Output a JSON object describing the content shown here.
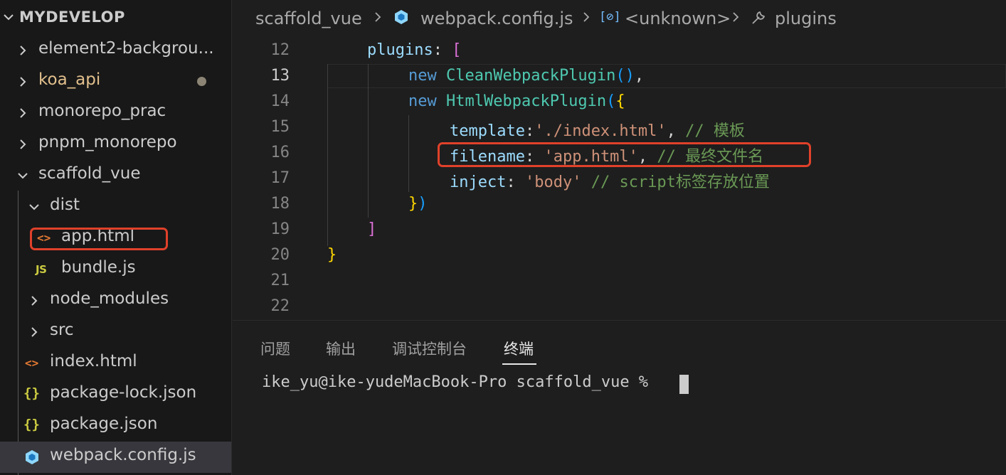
{
  "explorer": {
    "title": "MYDEVELOP",
    "items": [
      {
        "label": "element2-backgrou...",
        "type": "folder",
        "collapsed": true
      },
      {
        "label": "koa_api",
        "type": "folder",
        "collapsed": true,
        "modified": true
      },
      {
        "label": "monorepo_prac",
        "type": "folder",
        "collapsed": true
      },
      {
        "label": "pnpm_monorepo",
        "type": "folder",
        "collapsed": true
      },
      {
        "label": "scaffold_vue",
        "type": "folder",
        "collapsed": false
      },
      {
        "label": "dist",
        "type": "folder",
        "collapsed": false
      },
      {
        "label": "app.html",
        "type": "html",
        "icon": "html-icon"
      },
      {
        "label": "bundle.js",
        "type": "js",
        "icon": "js-icon"
      },
      {
        "label": "node_modules",
        "type": "folder",
        "collapsed": true
      },
      {
        "label": "src",
        "type": "folder",
        "collapsed": true
      },
      {
        "label": "index.html",
        "type": "html",
        "icon": "html-icon"
      },
      {
        "label": "package-lock.json",
        "type": "json",
        "icon": "json-icon"
      },
      {
        "label": "package.json",
        "type": "json",
        "icon": "json-icon"
      },
      {
        "label": "webpack.config.js",
        "type": "webpack",
        "icon": "webpack-icon",
        "active": true
      }
    ],
    "icons": {
      "html": "<>",
      "js": "JS",
      "json": "{}"
    }
  },
  "breadcrumb": {
    "folder": "scaffold_vue",
    "file": "webpack.config.js",
    "symbol": "<unknown>",
    "property": "plugins"
  },
  "editor": {
    "current_line": 13,
    "lines": [
      {
        "num": "12"
      },
      {
        "num": "13"
      },
      {
        "num": "14"
      },
      {
        "num": "15"
      },
      {
        "num": "16"
      },
      {
        "num": "17"
      },
      {
        "num": "18"
      },
      {
        "num": "19"
      },
      {
        "num": "20"
      },
      {
        "num": "21"
      },
      {
        "num": "22"
      }
    ],
    "code": {
      "l12_key": "plugins",
      "l12_rest": ": ",
      "l12_bracket": "[",
      "l13_new": "new",
      "l13_class": "CleanWebpackPlugin",
      "l13_paren_open": "(",
      "l13_paren_close": ")",
      "l13_comma": ",",
      "l14_new": "new",
      "l14_class": "HtmlWebpackPlugin",
      "l14_paren": "(",
      "l14_brace": "{",
      "l15_key": "template",
      "l15_colon": ":",
      "l15_value": "'./index.html'",
      "l15_comma": ", ",
      "l15_comment": "// 模板",
      "l16_key": "filename",
      "l16_colon": ": ",
      "l16_value": "'app.html'",
      "l16_comma": ", ",
      "l16_comment": "// 最终文件名",
      "l17_key": "inject",
      "l17_colon": ": ",
      "l17_value": "'body'",
      "l17_space": " ",
      "l17_comment": "// script标签存放位置",
      "l18_brace": "}",
      "l18_paren": ")",
      "l19_bracket": "]",
      "l20_brace": "}"
    }
  },
  "panel": {
    "tabs": [
      "问题",
      "输出",
      "调试控制台",
      "终端"
    ],
    "active_tab": "终端",
    "terminal_prompt": "ike_yu@ike-yudeMacBook-Pro scaffold_vue % "
  },
  "colors": {
    "highlight": "#e0412a",
    "keyword": "#569cd6",
    "class": "#4ec9b0",
    "property": "#9cdcfe",
    "string": "#ce9178",
    "comment": "#6a9955"
  }
}
